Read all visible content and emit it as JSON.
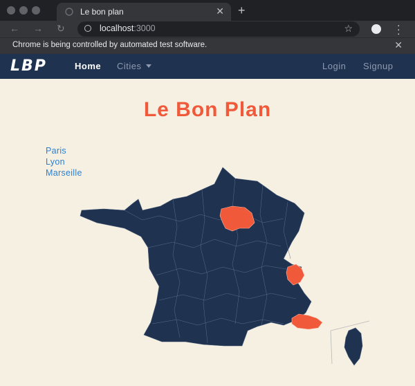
{
  "browser": {
    "tab_title": "Le bon plan",
    "url_host": "localhost",
    "url_port": ":3000",
    "automation_notice": "Chrome is being controlled by automated test software."
  },
  "navbar": {
    "logo": "LBP",
    "links": [
      "Home",
      "Cities",
      "Login",
      "Signup"
    ]
  },
  "page": {
    "title": "Le Bon Plan",
    "cities": [
      "Paris",
      "Lyon",
      "Marseille"
    ]
  },
  "colors": {
    "map_fill": "#1f3250",
    "highlight": "#f05a3a",
    "title": "#f05a3a",
    "link": "#2a7fd4",
    "background": "#f5f0e2"
  }
}
